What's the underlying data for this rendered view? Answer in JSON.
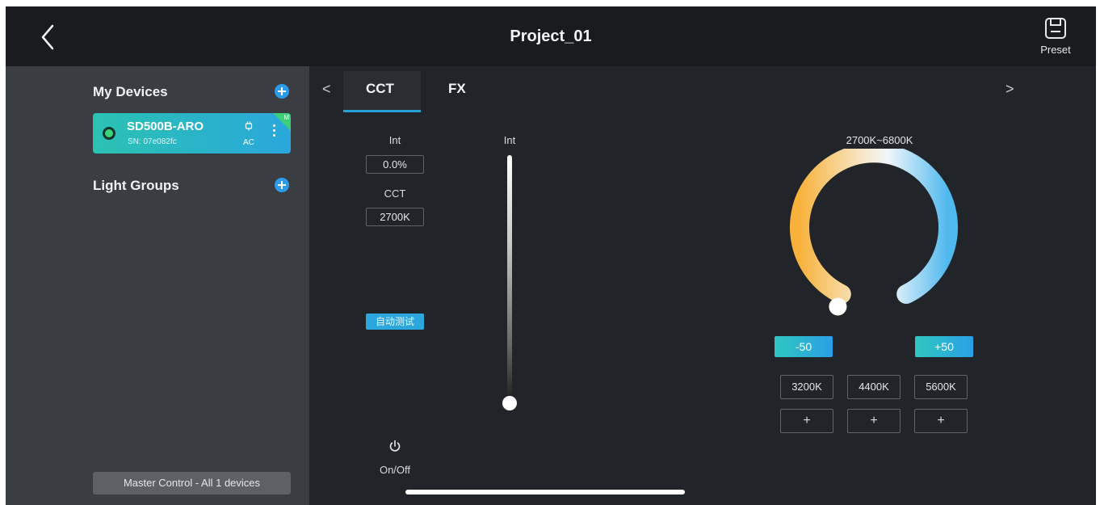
{
  "header": {
    "title": "Project_01",
    "preset_label": "Preset",
    "back_icon": "chevron-left-icon",
    "preset_icon": "save-icon"
  },
  "sidebar": {
    "my_devices_title": "My Devices",
    "device": {
      "name": "SD500B-ARO",
      "sn": "SN: 07e082fc",
      "power_source": "AC",
      "corner_tag": "M",
      "status_color": "#3dd27b"
    },
    "light_groups_title": "Light Groups",
    "master_control_label": "Master Control - All 1 devices",
    "accent_color": "#2e9be8"
  },
  "tabs": {
    "items": [
      {
        "label": "CCT",
        "active": true
      },
      {
        "label": "FX",
        "active": false
      }
    ],
    "prev_icon": "<",
    "next_icon": ">"
  },
  "controls": {
    "int_label": "Int",
    "int_value": "0.0%",
    "cct_label": "CCT",
    "cct_value": "2700K",
    "auto_test_label": "自动测试",
    "onoff_label": "On/Off",
    "slider_label": "Int",
    "slider_level": 0.0
  },
  "cct_dial": {
    "range_label": "2700K~6800K",
    "minus_label": "-50",
    "plus_label": "+50",
    "presets": [
      "3200K",
      "4400K",
      "5600K"
    ],
    "add_labels": [
      "+",
      "+",
      "+"
    ],
    "dial_position": 0.0,
    "warm_color": "#f8b23c",
    "cool_color": "#4fb8ee"
  }
}
